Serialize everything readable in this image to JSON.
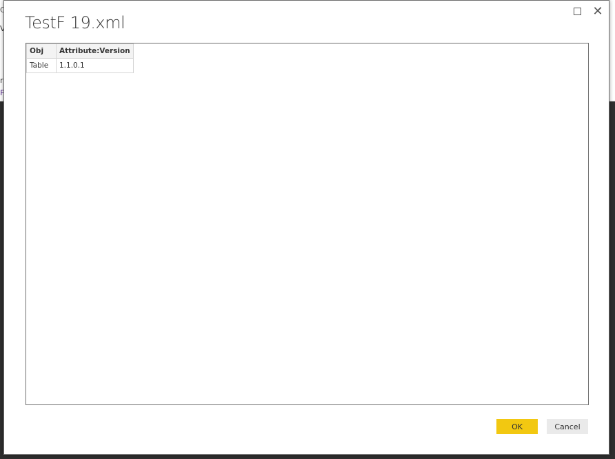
{
  "background": {
    "frag1": "C",
    "frag2": "V",
    "frag3": "ra",
    "frag4": "P"
  },
  "dialog": {
    "title": "TestF   19.xml",
    "maximize_icon": "maximize-icon",
    "close_icon": "close-icon",
    "table": {
      "columns": [
        "Obj",
        "Attribute:Version"
      ],
      "rows": [
        [
          "Table",
          "1.1.0.1"
        ]
      ]
    },
    "ok_label": "OK",
    "cancel_label": "Cancel"
  },
  "colors": {
    "ok": "#f2c811",
    "cancel": "#eaeaea"
  }
}
